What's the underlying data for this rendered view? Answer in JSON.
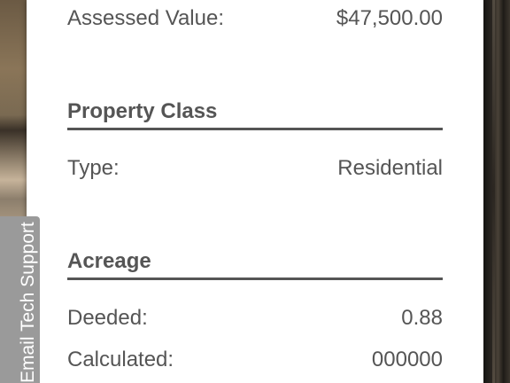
{
  "assessment": {
    "assessed_value_label": "Assessed Value:",
    "assessed_value": "$47,500.00"
  },
  "property_class": {
    "title": "Property Class",
    "type_label": "Type:",
    "type_value": "Residential"
  },
  "acreage": {
    "title": "Acreage",
    "deeded_label": "Deeded:",
    "deeded_value": "0.88",
    "calculated_label": "Calculated:",
    "calculated_value": "000000"
  },
  "support_tab": {
    "label": "Email Tech Support"
  },
  "colors": {
    "text": "#555555",
    "rule": "#555555",
    "tab_background": "#9a9a9a",
    "tab_text": "#ffffff",
    "panel": "#ffffff"
  }
}
